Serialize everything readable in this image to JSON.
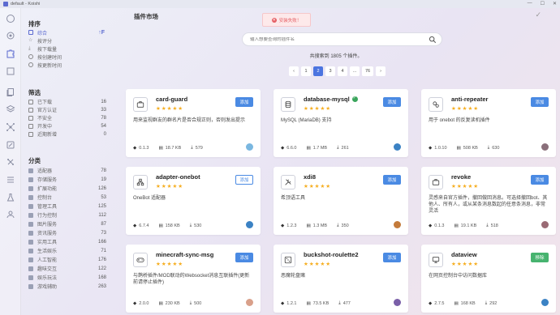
{
  "window": {
    "title": "default - Koishi"
  },
  "activity_icons": [
    "home-icon",
    "settings-icon",
    "plugin-icon",
    "deps-icon",
    "copy-icon",
    "layers-icon",
    "network-icon",
    "edit-icon",
    "sandbox-icon",
    "list-icon",
    "flask-icon",
    "people-icon"
  ],
  "sidebar": {
    "sort_title": "排序",
    "sort_items": [
      {
        "label": "综合",
        "active": true
      },
      {
        "label": "按评分"
      },
      {
        "label": "按下载量"
      },
      {
        "label": "按创建时间"
      },
      {
        "label": "按更新时间"
      }
    ],
    "sort_toggle": "↑F",
    "filter_title": "筛选",
    "filter_items": [
      {
        "label": "已下载",
        "count": "16"
      },
      {
        "label": "官方认证",
        "count": "33"
      },
      {
        "label": "不安全",
        "count": "78"
      },
      {
        "label": "开发中",
        "count": "54"
      },
      {
        "label": "近期新增",
        "count": "0"
      }
    ],
    "category_title": "分类",
    "category_items": [
      {
        "label": "适配器",
        "count": "78"
      },
      {
        "label": "存储服务",
        "count": "19"
      },
      {
        "label": "扩展功能",
        "count": "126"
      },
      {
        "label": "控制台",
        "count": "53"
      },
      {
        "label": "管理工具",
        "count": "125"
      },
      {
        "label": "行为控制",
        "count": "112"
      },
      {
        "label": "图片服务",
        "count": "87"
      },
      {
        "label": "资讯服务",
        "count": "73"
      },
      {
        "label": "实用工具",
        "count": "166"
      },
      {
        "label": "生活娱乐",
        "count": "71"
      },
      {
        "label": "人工智能",
        "count": "176"
      },
      {
        "label": "趣味交互",
        "count": "122"
      },
      {
        "label": "娱乐玩法",
        "count": "168"
      },
      {
        "label": "游戏辅助",
        "count": "263"
      }
    ]
  },
  "main": {
    "title": "插件市场",
    "toast": "安装失败！",
    "search_placeholder": "输入想要查询的插件名",
    "result_text": "共搜索到 1805 个插件。",
    "pager": [
      "‹",
      "1",
      "2",
      "3",
      "4",
      "…",
      "76",
      "›"
    ],
    "active_page": "2"
  },
  "cards": [
    {
      "name": "card-guard",
      "icon": "briefcase-icon",
      "stars": "★★★★★",
      "button": "添加",
      "button_style": "primary",
      "desc": "用来监视群友的群名片是否合规正则，否则发出提示",
      "version": "0.1.3",
      "size": "18.7 KB",
      "downloads": "579",
      "avatar_color": "#7ab7e0"
    },
    {
      "name": "database-mysql",
      "icon": "database-icon",
      "verified": true,
      "stars": "★★★★★",
      "button": "添加",
      "button_style": "primary",
      "desc": "MySQL (MariaDB) 支持",
      "version": "6.6.0",
      "size": "1.7 MB",
      "downloads": "261",
      "avatar_color": "#3b82c4"
    },
    {
      "name": "anti-repeater",
      "icon": "gears-icon",
      "stars": "★★★★★",
      "button": "添加",
      "button_style": "primary",
      "desc": "用于 onebot 的反复读机插件",
      "version": "1.0.10",
      "size": "508 KB",
      "downloads": "630",
      "avatar_color": "#8a6f7a"
    },
    {
      "name": "adapter-onebot",
      "icon": "network-icon",
      "stars": "★★★★★",
      "button": "添加",
      "button_style": "outline",
      "desc": "OneBot 适配器",
      "version": "6.7.4",
      "size": "158 KB",
      "downloads": "530",
      "avatar_color": "#3b82c4"
    },
    {
      "name": "xdi8",
      "icon": "tools-icon",
      "stars": "★★★★★",
      "button": "添加",
      "button_style": "primary",
      "desc": "希顶语工具",
      "version": "1.2.3",
      "size": "1.3 MB",
      "downloads": "350",
      "avatar_color": "#c47b3b"
    },
    {
      "name": "revoke",
      "icon": "briefcase-icon",
      "stars": "★★★★★",
      "button": "添加",
      "button_style": "primary",
      "desc": "灵感来自官方插件，撤回做回消息。可选择撤回bot、其他人、所有人，或从某条消息数起的任意条消息，非常灵活",
      "version": "0.1.3",
      "size": "19.1 KB",
      "downloads": "518",
      "avatar_color": "#9a6a74"
    },
    {
      "name": "minecraft-sync-msg",
      "icon": "gamepad-icon",
      "stars": "★★★★★",
      "button": "添加",
      "button_style": "primary",
      "desc": "与鹊桥插件/MOD联动的Websocket消息互联插件(更新前请停止插件)",
      "version": "2.0.0",
      "size": "230 KB",
      "downloads": "500",
      "avatar_color": "#d9a08a"
    },
    {
      "name": "buckshot-roulette2",
      "icon": "dice-icon",
      "stars": "★★★★★",
      "button": "添加",
      "button_style": "primary",
      "desc": "恶魔轮盘赌",
      "version": "1.2.1",
      "size": "73.5 KB",
      "downloads": "477",
      "avatar_color": "#7a5fa8"
    },
    {
      "name": "dataview",
      "icon": "monitor-icon",
      "stars": "★★★★★",
      "button": "移除",
      "button_style": "green",
      "desc": "在网页控制台中访问数据库",
      "version": "2.7.5",
      "size": "168 KB",
      "downloads": "292",
      "avatar_color": "#3b82c4"
    }
  ],
  "colors": {
    "accent": "#4b74e0",
    "primary_button": "#4a8ae3",
    "star": "#f6ad1d",
    "remove_button": "#47b36f",
    "toast": "#e55e64"
  }
}
